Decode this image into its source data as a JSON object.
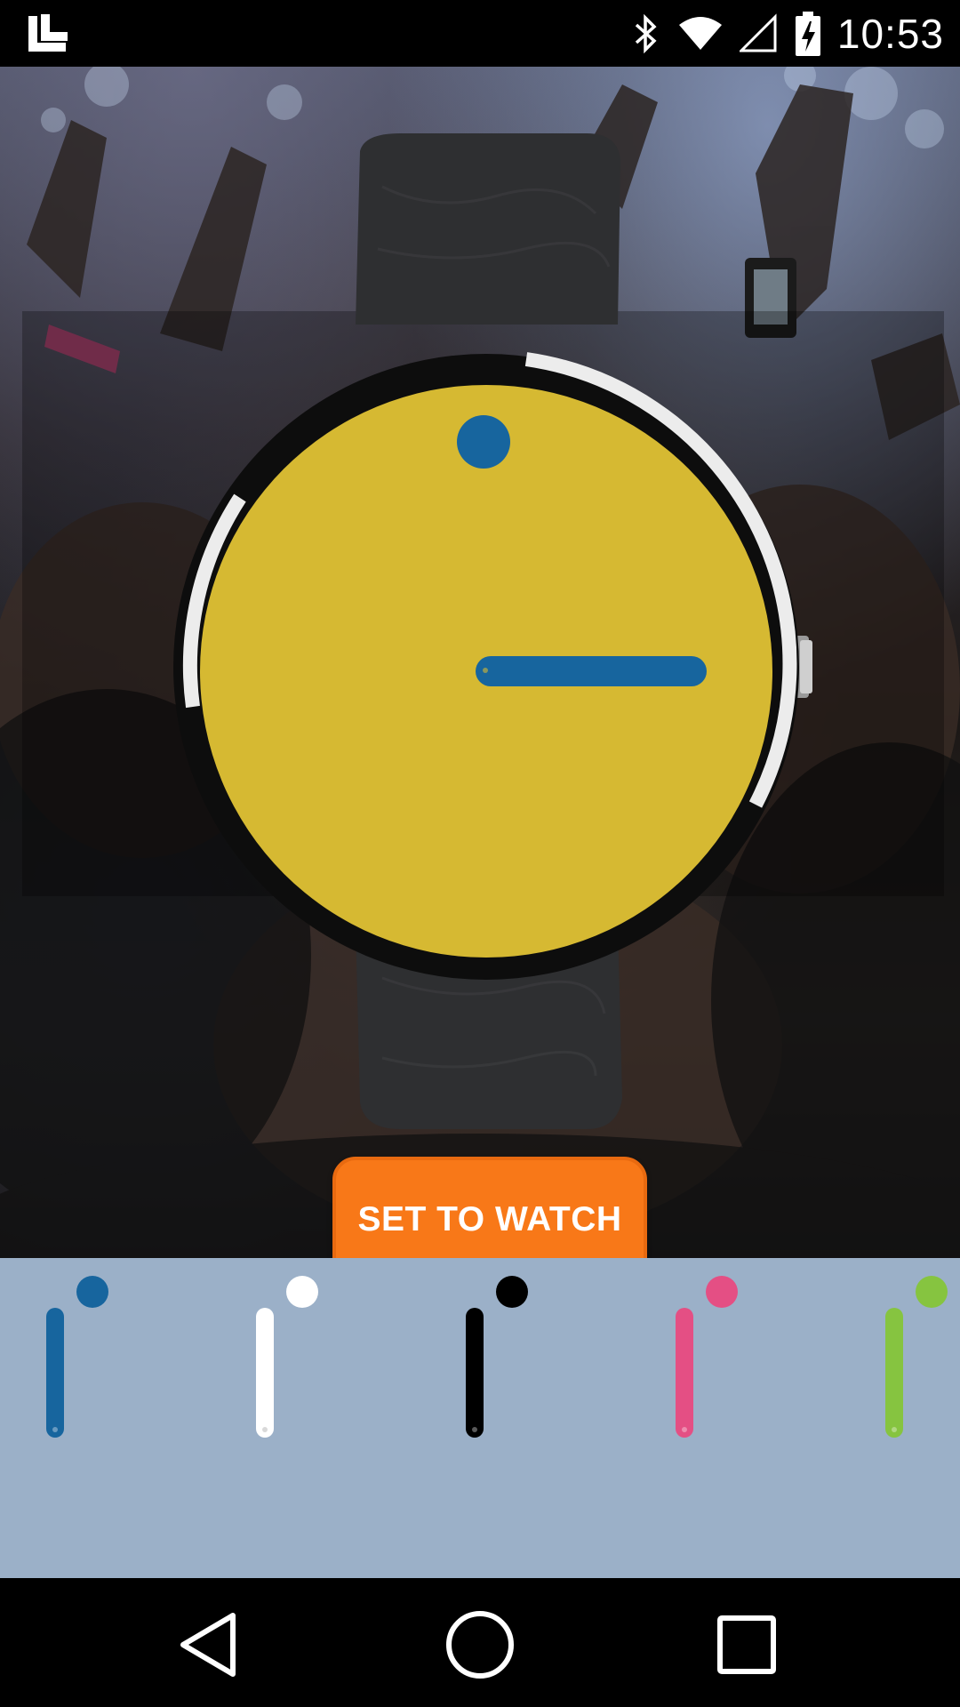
{
  "status_bar": {
    "time": "10:53",
    "icons": [
      "launcher-icon",
      "bluetooth-icon",
      "wifi-icon",
      "cell-signal-icon",
      "battery-charging-icon"
    ]
  },
  "watch_preview": {
    "face_color": "#d6b932",
    "hand_color": "#17659e",
    "bezel_color": "#111111",
    "band_color": "#2e2f31"
  },
  "actions": {
    "set_to_watch_label": "SET TO WATCH",
    "set_to_watch_color": "#f87818"
  },
  "color_options": [
    {
      "name": "blue",
      "color": "#17659e"
    },
    {
      "name": "white",
      "color": "#ffffff"
    },
    {
      "name": "black",
      "color": "#000000"
    },
    {
      "name": "pink",
      "color": "#e44f84"
    },
    {
      "name": "green",
      "color": "#86c440"
    }
  ],
  "picker_background": "#9bb0c8",
  "navigation": [
    "back-icon",
    "home-icon",
    "recents-icon"
  ]
}
